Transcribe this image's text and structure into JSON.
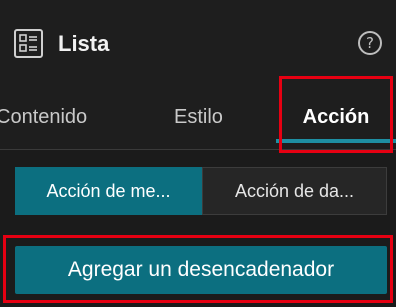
{
  "header": {
    "title": "Lista",
    "list_icon": "list-widget-icon",
    "help_icon": "help-circle-icon",
    "help_glyph": "?"
  },
  "tabs": [
    {
      "label": "Contenido",
      "active": false
    },
    {
      "label": "Estilo",
      "active": false
    },
    {
      "label": "Acción",
      "active": true
    }
  ],
  "action_types": {
    "options": [
      {
        "label": "Acción de me...",
        "selected": true
      },
      {
        "label": "Acción de da...",
        "selected": false
      }
    ]
  },
  "add_trigger_label": "Agregar un desencadenador",
  "colors": {
    "accent": "#0c6f80",
    "tab_underline": "#1e8fa3",
    "highlight": "#e60012",
    "background": "#1b1b1b"
  }
}
